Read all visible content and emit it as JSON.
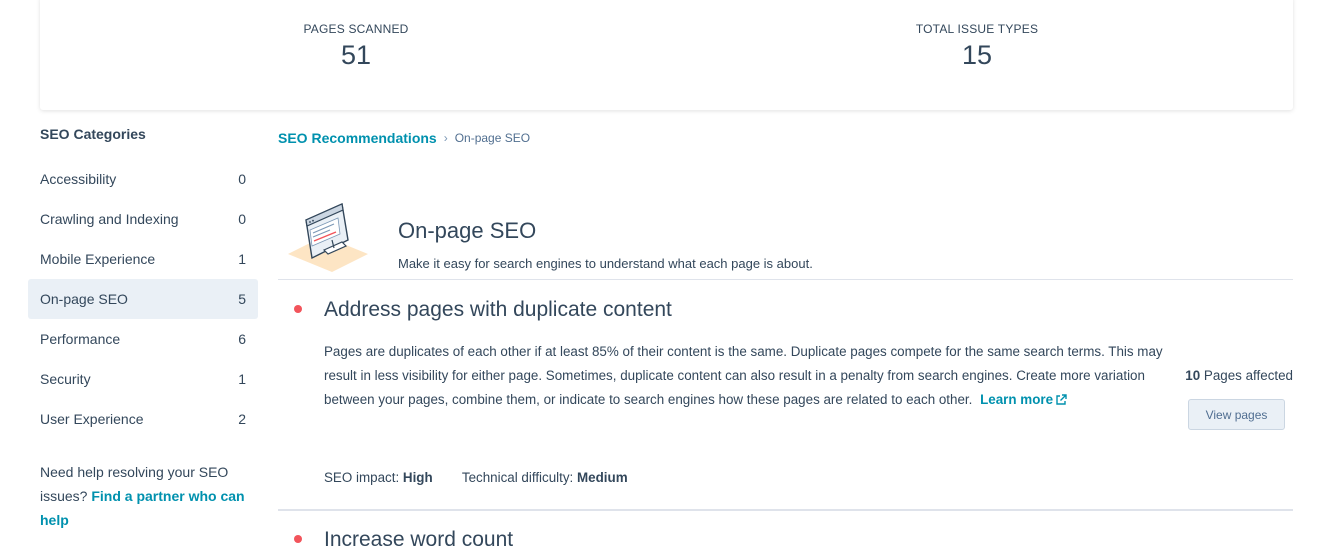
{
  "stats": {
    "pages_scanned_label": "PAGES SCANNED",
    "pages_scanned_value": "51",
    "issue_types_label": "TOTAL ISSUE TYPES",
    "issue_types_value": "15"
  },
  "sidebar": {
    "title": "SEO Categories",
    "items": [
      {
        "label": "Accessibility",
        "count": "0"
      },
      {
        "label": "Crawling and Indexing",
        "count": "0"
      },
      {
        "label": "Mobile Experience",
        "count": "1"
      },
      {
        "label": "On-page SEO",
        "count": "5"
      },
      {
        "label": "Performance",
        "count": "6"
      },
      {
        "label": "Security",
        "count": "1"
      },
      {
        "label": "User Experience",
        "count": "2"
      }
    ],
    "help_text": "Need help resolving your SEO issues?",
    "help_link": "Find a partner who can help"
  },
  "breadcrumb": {
    "parent": "SEO Recommendations",
    "separator": "›",
    "current": "On-page SEO"
  },
  "header": {
    "title": "On-page SEO",
    "description": "Make it easy for search engines to understand what each page is about."
  },
  "issues": [
    {
      "title": "Address pages with duplicate content",
      "body": "Pages are duplicates of each other if at least 85% of their content is the same. Duplicate pages compete for the same search terms. This may result in less visibility for either page. Sometimes, duplicate content can also result in a penalty from search engines. Create more variation between your pages, combine them, or indicate to search engines how these pages are related to each other.",
      "learn_more": "Learn more",
      "affected_count": "10",
      "affected_label": "Pages affected",
      "view_button": "View pages",
      "impact_label": "SEO impact:",
      "impact_value": "High",
      "difficulty_label": "Technical difficulty:",
      "difficulty_value": "Medium"
    },
    {
      "title": "Increase word count"
    }
  ],
  "colors": {
    "accent": "#0091ae",
    "text": "#33475b",
    "active_bg": "#eaf0f6",
    "severity_dot": "#f2545b"
  }
}
